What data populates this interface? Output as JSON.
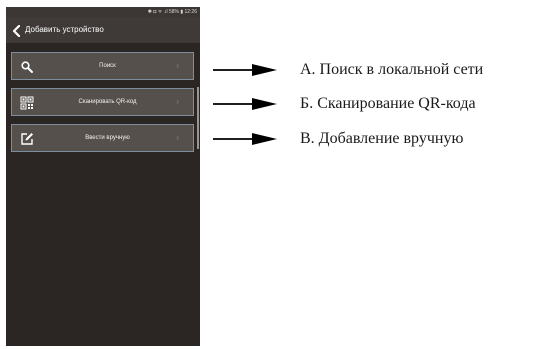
{
  "status_bar": {
    "text": "✱ ◘ ᯤ .ıl 58% ▮ 12:26"
  },
  "app_bar": {
    "back_icon": "chevron-left-icon",
    "title": "Добавить устройство"
  },
  "menu": {
    "items": [
      {
        "icon": "search-icon",
        "label": "Поиск"
      },
      {
        "icon": "qr-code-icon",
        "label": "Сканировать QR-код"
      },
      {
        "icon": "edit-icon",
        "label": "Ввести вручную"
      }
    ],
    "chevron": "›"
  },
  "annotations": {
    "a": "А. Поиск в локальной сети",
    "b": "Б. Сканирование QR-кода",
    "c": "В. Добавление вручную"
  },
  "colors": {
    "background": "#2b2624",
    "app_bar": "#3f3a38",
    "row_fill": "#56504c",
    "row_border": "#7d8ea0"
  }
}
